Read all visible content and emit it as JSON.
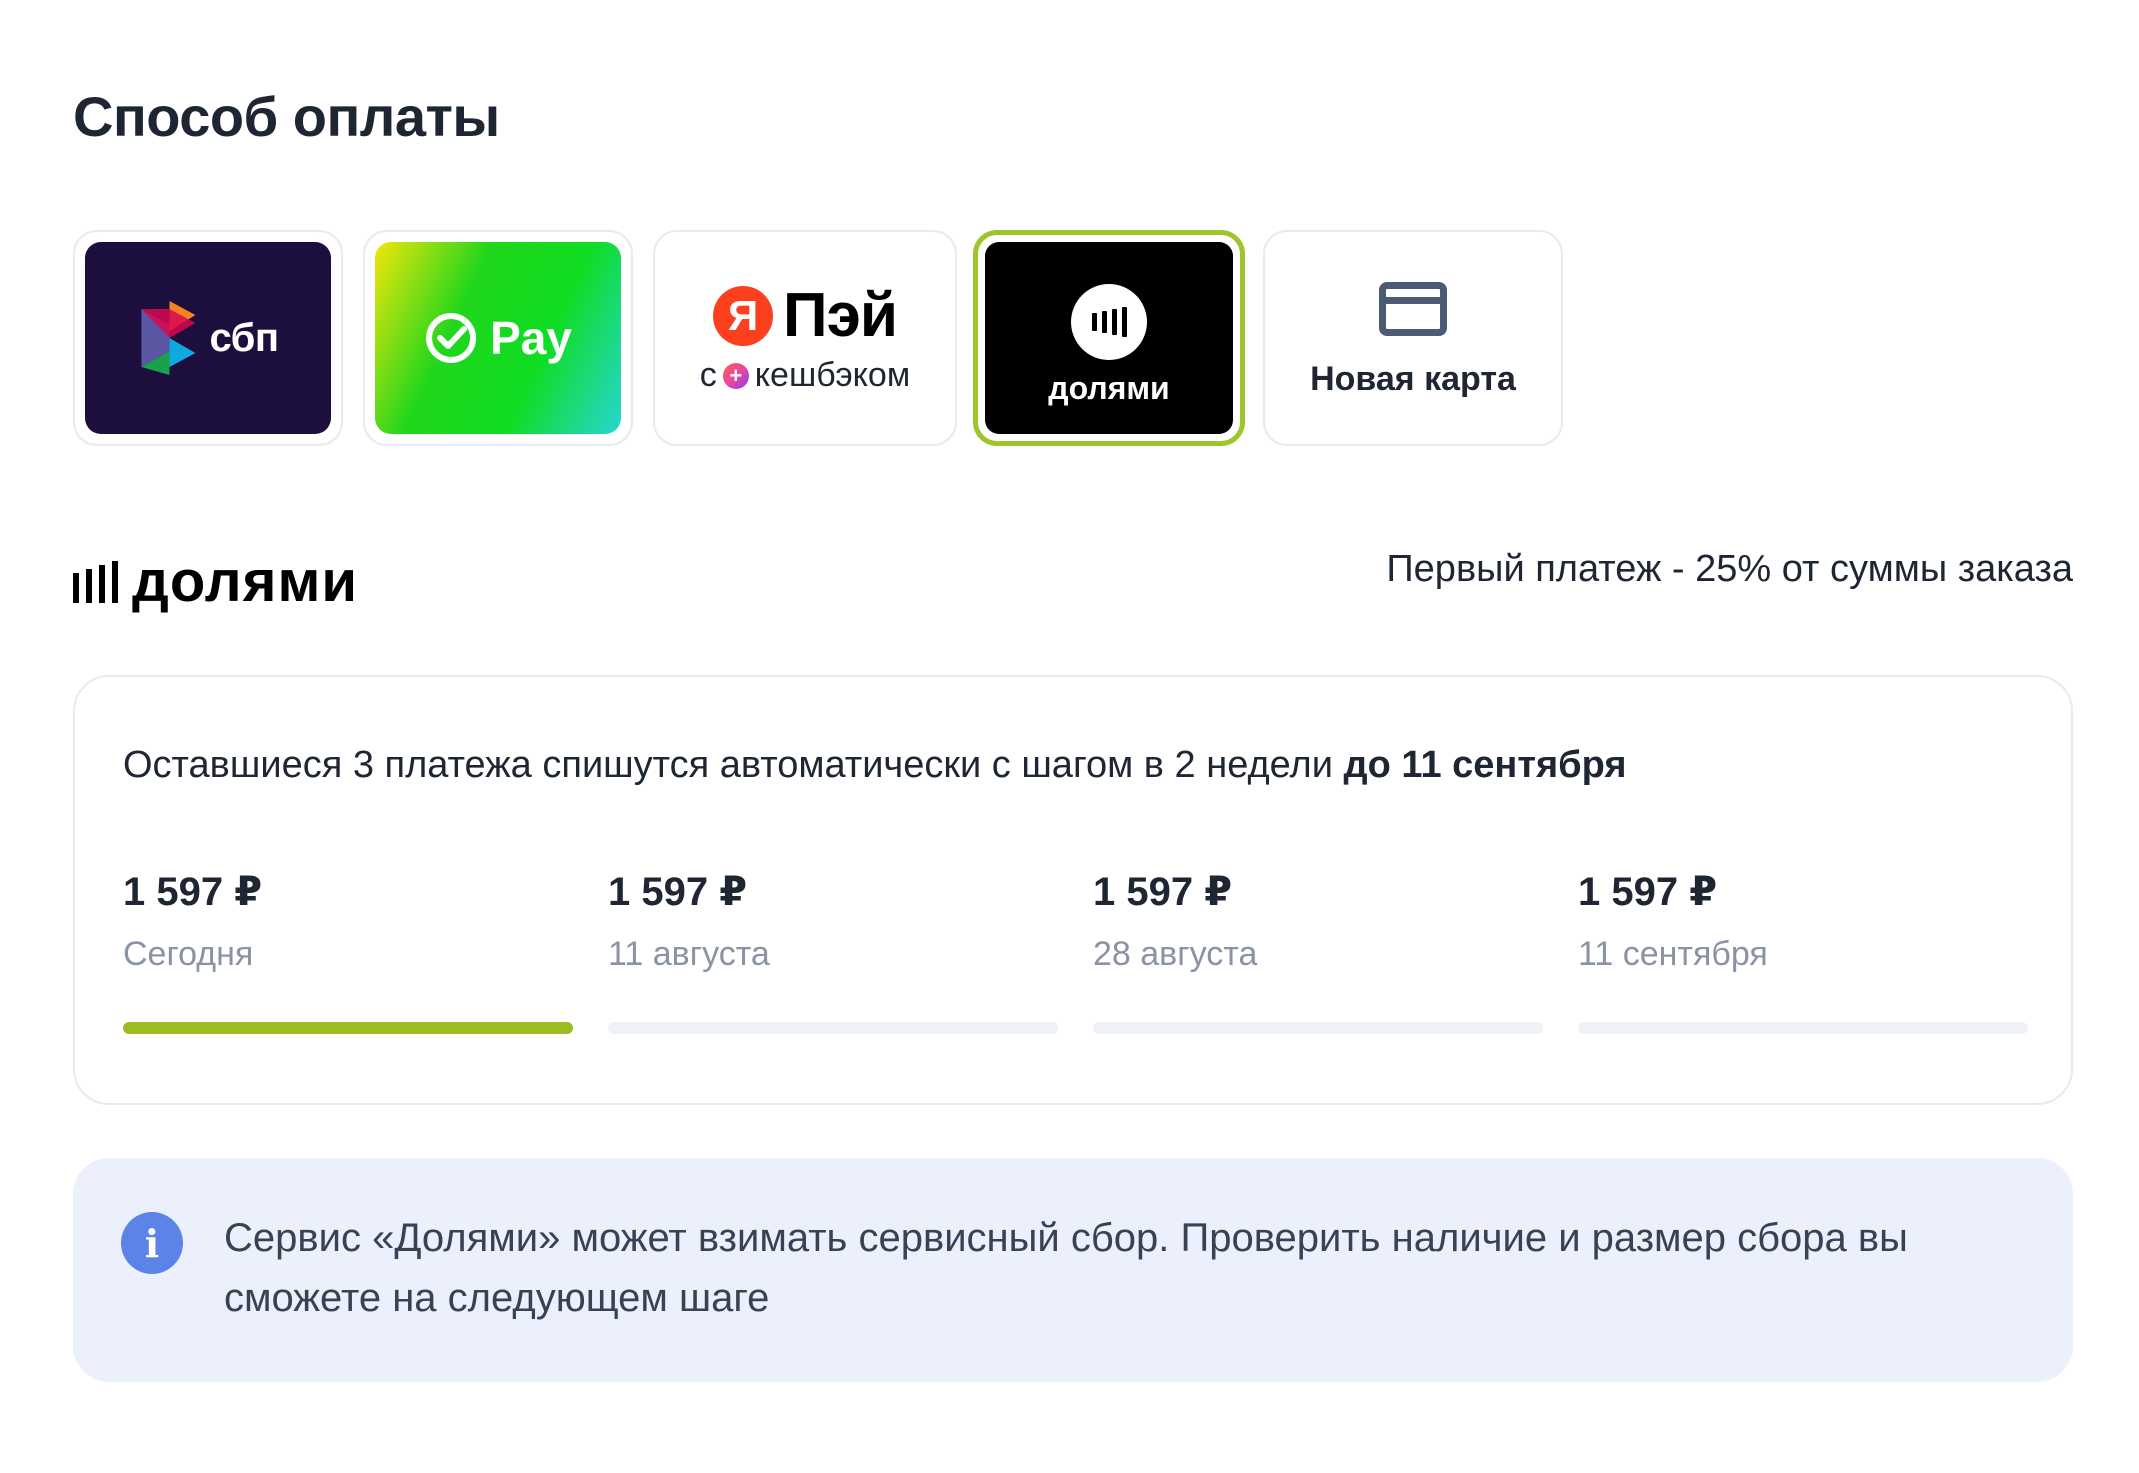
{
  "title": "Способ оплаты",
  "methods": {
    "sbp": {
      "label": "сбп",
      "icon": "sbp-logo-icon",
      "bg": "#1c0f3d"
    },
    "sberpay": {
      "label": "Pay",
      "icon": "sber-check-icon"
    },
    "yandex_pay": {
      "logo_letter": "Я",
      "label": "Пэй",
      "sub_prefix": "с",
      "sub_label": "кешбэком"
    },
    "dolyami": {
      "label": "долями",
      "selected": true,
      "accent": "#9ec52a"
    },
    "new_card": {
      "label": "Новая карта",
      "icon": "credit-card-icon"
    }
  },
  "dolyami_section": {
    "brand": "долями",
    "first_payment": "Первый платеж - 25% от суммы заказа"
  },
  "schedule": {
    "text": "Оставшиеся 3 платежа спишутся автоматически с шагом в 2 недели",
    "text_bold": "до 11 сентября",
    "installments": [
      {
        "amount": "1 597 ₽",
        "date": "Сегодня",
        "paid": true
      },
      {
        "amount": "1 597 ₽",
        "date": "11 августа",
        "paid": false
      },
      {
        "amount": "1 597 ₽",
        "date": "28 августа",
        "paid": false
      },
      {
        "amount": "1 597 ₽",
        "date": "11 сентября",
        "paid": false
      }
    ],
    "progress_color": "#9bbd22"
  },
  "notice": {
    "icon": "info-icon",
    "icon_glyph": "i",
    "text": "Сервис «Долями» может взимать сервисный сбор. Проверить наличие и размер сбора вы сможете на следующем шаге"
  }
}
